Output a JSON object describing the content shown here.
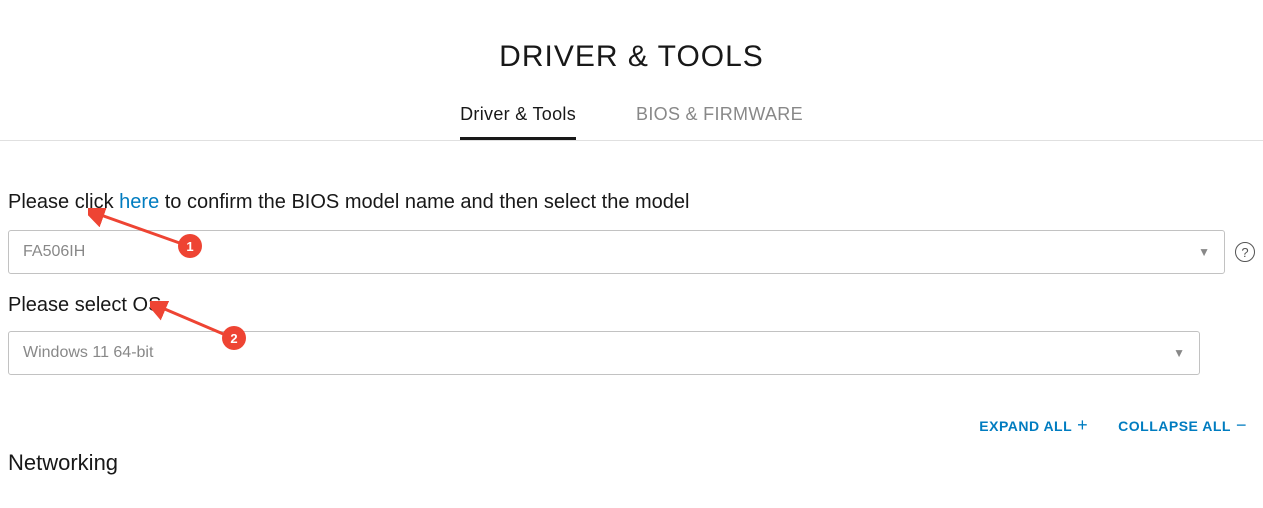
{
  "pageTitle": "DRIVER & TOOLS",
  "tabs": {
    "driverTools": "Driver & Tools",
    "biosFirmware": "BIOS & FIRMWARE"
  },
  "instruction": {
    "prefix": "Please click ",
    "linkText": "here",
    "suffix": " to confirm the BIOS model name and then select the model"
  },
  "modelSelect": {
    "value": "FA506IH"
  },
  "osLabel": "Please select OS",
  "osSelect": {
    "value": "Windows 11 64-bit"
  },
  "actions": {
    "expand": "EXPAND ALL",
    "collapse": "COLLAPSE ALL"
  },
  "sectionTitle": "Networking",
  "helpTooltip": "?",
  "annotations": {
    "badge1": "1",
    "badge2": "2"
  }
}
